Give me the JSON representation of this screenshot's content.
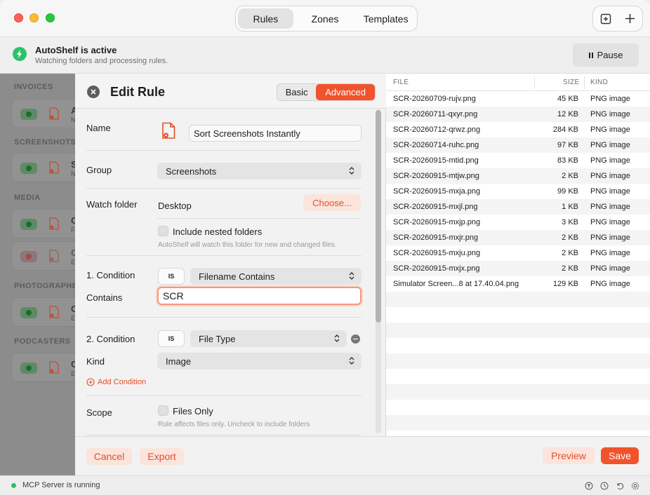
{
  "toolbar": {
    "tabs": [
      {
        "label": "Rules",
        "active": true
      },
      {
        "label": "Zones",
        "active": false
      },
      {
        "label": "Templates",
        "active": false
      }
    ]
  },
  "banner": {
    "title": "AutoShelf is active",
    "subtitle": "Watching folders and processing rules.",
    "pause_label": "Pause"
  },
  "sidebar": {
    "sections": [
      "INVOICES",
      "SCREENSHOTS",
      "MEDIA",
      "PHOTOGRAPHERS",
      "PODCASTERS"
    ],
    "cards": [
      {
        "letter": "A",
        "sub": "N"
      },
      {
        "letter": "S",
        "sub": "N"
      },
      {
        "letter": "C",
        "sub": "F"
      },
      {
        "letter": "C",
        "sub": "E"
      },
      {
        "letter": "C",
        "sub": "E"
      },
      {
        "letter": "C",
        "sub": "E"
      }
    ]
  },
  "editor": {
    "title": "Edit Rule",
    "mode_basic": "Basic",
    "mode_advanced": "Advanced",
    "name_label": "Name",
    "name_value": "Sort Screenshots Instantly",
    "group_label": "Group",
    "group_value": "Screenshots",
    "watch_label": "Watch folder",
    "watch_value": "Desktop",
    "choose_label": "Choose...",
    "nested_label": "Include nested folders",
    "watch_hint": "AutoShelf will watch this folder for new and changed files.",
    "cond1_label": "1. Condition",
    "cond1_op": "IS",
    "cond1_type": "Filename Contains",
    "contains_label": "Contains",
    "contains_value": "SCR",
    "cond2_label": "2. Condition",
    "cond2_op": "IS",
    "cond2_type": "File Type",
    "kind_label": "Kind",
    "kind_value": "Image",
    "add_condition": "Add Condition",
    "scope_label": "Scope",
    "files_only_label": "Files Only",
    "scope_hint": "Rule affects files only. Uncheck to include folders",
    "cancel": "Cancel",
    "export": "Export",
    "preview": "Preview",
    "save": "Save"
  },
  "files": {
    "headers": {
      "file": "FILE",
      "size": "SIZE",
      "kind": "KIND"
    },
    "rows": [
      {
        "name": "SCR-20260709-rujv.png",
        "size": "45 KB",
        "kind": "PNG image"
      },
      {
        "name": "SCR-20260711-qxyr.png",
        "size": "12 KB",
        "kind": "PNG image"
      },
      {
        "name": "SCR-20260712-qrwz.png",
        "size": "284 KB",
        "kind": "PNG image"
      },
      {
        "name": "SCR-20260714-ruhc.png",
        "size": "97 KB",
        "kind": "PNG image"
      },
      {
        "name": "SCR-20260915-mtid.png",
        "size": "83 KB",
        "kind": "PNG image"
      },
      {
        "name": "SCR-20260915-mtjw.png",
        "size": "2 KB",
        "kind": "PNG image"
      },
      {
        "name": "SCR-20260915-mxja.png",
        "size": "99 KB",
        "kind": "PNG image"
      },
      {
        "name": "SCR-20260915-mxjl.png",
        "size": "1 KB",
        "kind": "PNG image"
      },
      {
        "name": "SCR-20260915-mxjp.png",
        "size": "3 KB",
        "kind": "PNG image"
      },
      {
        "name": "SCR-20260915-mxjr.png",
        "size": "2 KB",
        "kind": "PNG image"
      },
      {
        "name": "SCR-20260915-mxju.png",
        "size": "2 KB",
        "kind": "PNG image"
      },
      {
        "name": "SCR-20260915-mxjx.png",
        "size": "2 KB",
        "kind": "PNG image"
      },
      {
        "name": "Simulator Screen...8 at 17.40.04.png",
        "size": "129 KB",
        "kind": "PNG image"
      }
    ]
  },
  "status": {
    "mcp": "MCP Server is running"
  },
  "colors": {
    "accent": "#f1532c",
    "active_green": "#2ec26a"
  }
}
